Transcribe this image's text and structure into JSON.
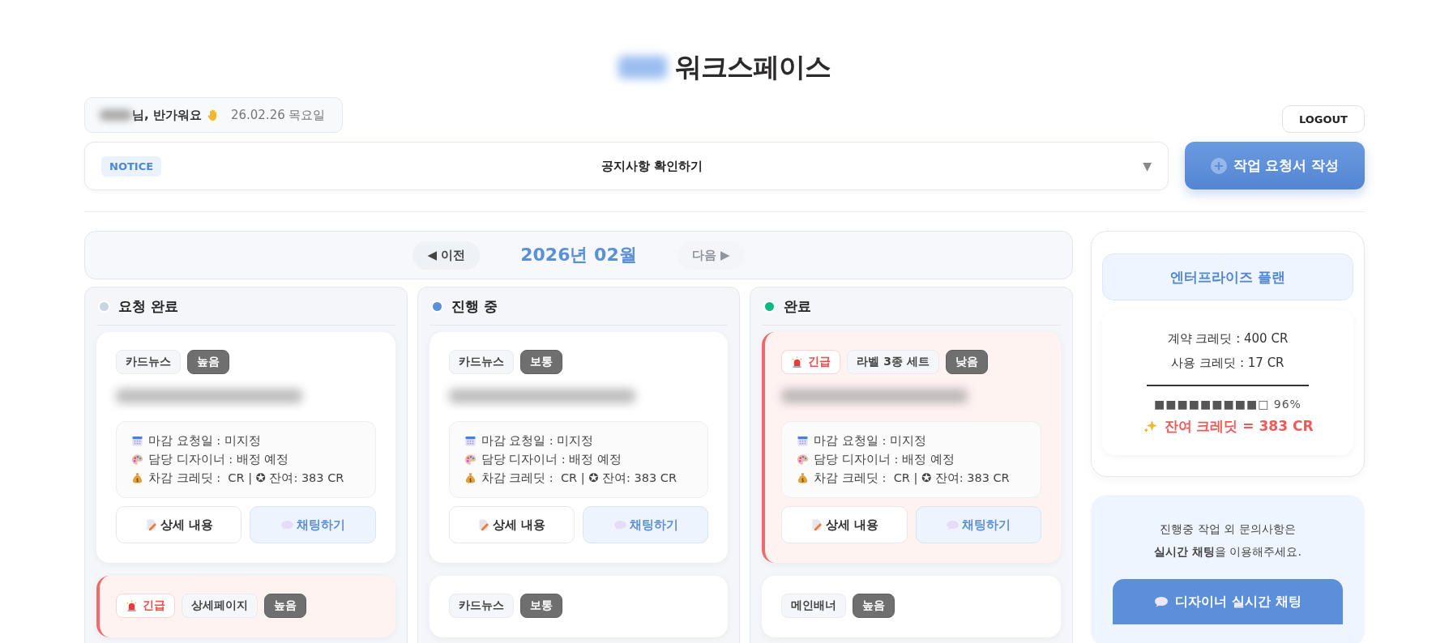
{
  "header": {
    "title": "워크스페이스",
    "greeting": "님, 반가워요",
    "date": "26.02.26 목요일",
    "logout": "LOGOUT"
  },
  "notice": {
    "badge": "NOTICE",
    "text": "공지사항 확인하기",
    "caret": "▼"
  },
  "create_button": {
    "label": "작업 요청서 작성"
  },
  "month_nav": {
    "prev": {
      "label": "◀ 이전",
      "disabled": false
    },
    "month": "2026년 02월",
    "next": {
      "label": "다음 ▶",
      "disabled": true
    }
  },
  "columns": [
    {
      "title": "요청 완료",
      "color": "#cbd5e1",
      "cards": [
        {
          "urgent": false,
          "category": "카드뉴스",
          "priority": "높음",
          "details": [
            {
              "kind": "calendar",
              "text": "마감 요청일 : 미지정"
            },
            {
              "kind": "palette",
              "text": "담당 디자이너 : 배정 예정"
            },
            {
              "kind": "money",
              "text": "차감 크레딧 :  CR | ✪ 잔여: 383 CR"
            }
          ],
          "buttons": [
            "상세 내용",
            "채팅하기"
          ]
        },
        {
          "urgent": true,
          "urgent_label": "긴급",
          "category": "상세페이지",
          "priority": "높음"
        }
      ]
    },
    {
      "title": "진행 중",
      "color": "#5b8fd9",
      "cards": [
        {
          "urgent": false,
          "category": "카드뉴스",
          "priority": "보통",
          "details": [
            {
              "kind": "calendar",
              "text": "마감 요청일 : 미지정"
            },
            {
              "kind": "palette",
              "text": "담당 디자이너 : 배정 예정"
            },
            {
              "kind": "money",
              "text": "차감 크레딧 :  CR | ✪ 잔여: 383 CR"
            }
          ],
          "buttons": [
            "상세 내용",
            "채팅하기"
          ]
        },
        {
          "urgent": false,
          "category": "카드뉴스",
          "priority": "보통"
        }
      ]
    },
    {
      "title": "완료",
      "color": "#10b981",
      "cards": [
        {
          "urgent": true,
          "urgent_label": "긴급",
          "category": "라벨 3종 세트",
          "priority": "낮음",
          "details": [
            {
              "kind": "calendar",
              "text": "마감 요청일 : 미지정"
            },
            {
              "kind": "palette",
              "text": "담당 디자이너 : 배정 예정"
            },
            {
              "kind": "money",
              "text": "차감 크레딧 :  CR | ✪ 잔여: 383 CR"
            }
          ],
          "buttons": [
            "상세 내용",
            "채팅하기"
          ]
        },
        {
          "urgent": false,
          "category": "메인배너",
          "priority": "높음"
        }
      ]
    }
  ],
  "plan": {
    "name": "엔터프라이즈 플랜",
    "contract": "계약 크레딧 : 400 CR",
    "used": "사용 크레딧 : 17 CR",
    "usage": "■■■■■■■■■□ 96%",
    "remaining": "잔여 크레딧 = 383 CR"
  },
  "chat_panel": {
    "message": "진행중 작업 외 문의사항은\n**실시간 채팅**을 이용해주세요.",
    "button": "디자이너 실시간 채팅"
  }
}
